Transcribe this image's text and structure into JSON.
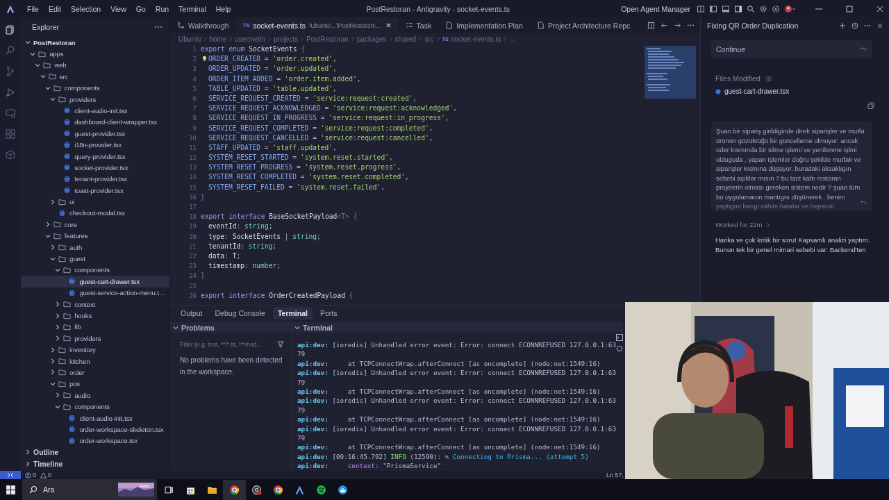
{
  "title_bar": {
    "menu": [
      "File",
      "Edit",
      "Selection",
      "View",
      "Go",
      "Run",
      "Terminal",
      "Help"
    ],
    "title": "PostRestoran - Antigravity - socket-events.ts",
    "agent_manager": "Open Agent Manager"
  },
  "explorer": {
    "title": "Explorer",
    "tree": [
      {
        "name": "PostRestoran",
        "kind": "root",
        "expanded": true,
        "selected": false,
        "children": [
          {
            "name": "apps",
            "kind": "folder",
            "expanded": true,
            "selected": false,
            "children": [
              {
                "name": "web",
                "kind": "folder",
                "expanded": true,
                "selected": false,
                "children": [
                  {
                    "name": "src",
                    "kind": "folder",
                    "expanded": true,
                    "selected": false,
                    "children": [
                      {
                        "name": "components",
                        "kind": "folder",
                        "expanded": true,
                        "selected": false,
                        "children": [
                          {
                            "name": "providers",
                            "kind": "folder",
                            "expanded": true,
                            "selected": false,
                            "children": [
                              {
                                "name": "client-audio-init.tsx",
                                "kind": "file",
                                "selected": false
                              },
                              {
                                "name": "dashboard-client-wrapper.tsx",
                                "kind": "file",
                                "selected": false
                              },
                              {
                                "name": "guest-provider.tsx",
                                "kind": "file",
                                "selected": false
                              },
                              {
                                "name": "i18n-provider.tsx",
                                "kind": "file",
                                "selected": false
                              },
                              {
                                "name": "query-provider.tsx",
                                "kind": "file",
                                "selected": false
                              },
                              {
                                "name": "socket-provider.tsx",
                                "kind": "file",
                                "selected": false
                              },
                              {
                                "name": "tenant-provider.tsx",
                                "kind": "file",
                                "selected": false
                              },
                              {
                                "name": "toast-provider.tsx",
                                "kind": "file",
                                "selected": false
                              }
                            ]
                          },
                          {
                            "name": "ui",
                            "kind": "folder",
                            "expanded": false,
                            "selected": false
                          },
                          {
                            "name": "checkout-modal.tsx",
                            "kind": "file",
                            "selected": false
                          }
                        ]
                      },
                      {
                        "name": "core",
                        "kind": "folder",
                        "expanded": false,
                        "selected": false
                      },
                      {
                        "name": "features",
                        "kind": "folder",
                        "expanded": true,
                        "selected": false,
                        "children": [
                          {
                            "name": "auth",
                            "kind": "folder",
                            "expanded": false,
                            "selected": false
                          },
                          {
                            "name": "guest",
                            "kind": "folder",
                            "expanded": true,
                            "selected": false,
                            "children": [
                              {
                                "name": "components",
                                "kind": "folder",
                                "expanded": true,
                                "selected": false,
                                "children": [
                                  {
                                    "name": "guest-cart-drawer.tsx",
                                    "kind": "file",
                                    "selected": true
                                  },
                                  {
                                    "name": "guest-service-action-menu.t…",
                                    "kind": "file",
                                    "selected": false
                                  }
                                ]
                              },
                              {
                                "name": "context",
                                "kind": "folder",
                                "expanded": false,
                                "selected": false
                              },
                              {
                                "name": "hooks",
                                "kind": "folder",
                                "expanded": false,
                                "selected": false
                              },
                              {
                                "name": "lib",
                                "kind": "folder",
                                "expanded": false,
                                "selected": false
                              },
                              {
                                "name": "providers",
                                "kind": "folder",
                                "expanded": false,
                                "selected": false
                              }
                            ]
                          },
                          {
                            "name": "inventory",
                            "kind": "folder",
                            "expanded": false,
                            "selected": false
                          },
                          {
                            "name": "kitchen",
                            "kind": "folder",
                            "expanded": false,
                            "selected": false
                          },
                          {
                            "name": "order",
                            "kind": "folder",
                            "expanded": false,
                            "selected": false
                          },
                          {
                            "name": "pos",
                            "kind": "folder",
                            "expanded": true,
                            "selected": false,
                            "children": [
                              {
                                "name": "audio",
                                "kind": "folder",
                                "expanded": false,
                                "selected": false
                              },
                              {
                                "name": "components",
                                "kind": "folder",
                                "expanded": true,
                                "selected": false,
                                "children": [
                                  {
                                    "name": "client-audio-init.tsx",
                                    "kind": "file",
                                    "selected": false
                                  },
                                  {
                                    "name": "order-workspace-skeleton.tsx",
                                    "kind": "file",
                                    "selected": false
                                  },
                                  {
                                    "name": "order-workspace.tsx",
                                    "kind": "file",
                                    "selected": false
                                  }
                                ]
                              }
                            ]
                          }
                        ]
                      }
                    ]
                  }
                ]
              }
            ]
          }
        ]
      }
    ],
    "sections": [
      {
        "name": "Outline",
        "expanded": false
      },
      {
        "name": "Timeline",
        "expanded": false
      }
    ]
  },
  "tabs": [
    {
      "label": "Walkthrough",
      "kind": "walkthrough",
      "selected": false
    },
    {
      "label": "socket-events.ts",
      "kind": "code",
      "icon_text": "TS",
      "detail": "\\Ubuntu\\...\\PostRestoran\\...",
      "selected": true
    },
    {
      "label": "Task",
      "kind": "task",
      "selected": false
    },
    {
      "label": "Implementation Plan",
      "kind": "doc",
      "selected": false
    },
    {
      "label": "Project Architecture Repc",
      "kind": "doc",
      "selected": false
    }
  ],
  "breadcrumbs": [
    "Ubuntu",
    "home",
    "usermetin",
    "projects",
    "PostRestoran",
    "packages",
    "shared",
    "src",
    "socket-events.ts",
    "..."
  ],
  "breadcrumb_file_icon": "TS",
  "code": [
    {
      "number": "1",
      "tokens": [
        {
          "kind": "keyword",
          "text": "export enum "
        },
        {
          "kind": "name",
          "text": "SocketEvents "
        },
        {
          "kind": "brace",
          "text": "{"
        }
      ]
    },
    {
      "number": "2",
      "hint": true,
      "indented": true,
      "tokens": [
        {
          "kind": "member",
          "text": "ORDER_CREATED"
        },
        {
          "kind": "punct",
          "text": " = "
        },
        {
          "kind": "string",
          "text": "'order.created'"
        },
        {
          "kind": "punct",
          "text": ","
        }
      ]
    },
    {
      "number": "3",
      "indented": true,
      "tokens": [
        {
          "kind": "member",
          "text": "ORDER_UPDATED"
        },
        {
          "kind": "punct",
          "text": " = "
        },
        {
          "kind": "string",
          "text": "'order.updated'"
        },
        {
          "kind": "punct",
          "text": ","
        }
      ]
    },
    {
      "number": "4",
      "indented": true,
      "tokens": [
        {
          "kind": "member",
          "text": "ORDER_ITEM_ADDED"
        },
        {
          "kind": "punct",
          "text": " = "
        },
        {
          "kind": "string",
          "text": "'order.item.added'"
        },
        {
          "kind": "punct",
          "text": ","
        }
      ]
    },
    {
      "number": "5",
      "indented": true,
      "tokens": [
        {
          "kind": "member",
          "text": "TABLE_UPDATED"
        },
        {
          "kind": "punct",
          "text": " = "
        },
        {
          "kind": "string",
          "text": "'table.updated'"
        },
        {
          "kind": "punct",
          "text": ","
        }
      ]
    },
    {
      "number": "6",
      "indented": true,
      "tokens": [
        {
          "kind": "member",
          "text": "SERVICE_REQUEST_CREATED"
        },
        {
          "kind": "punct",
          "text": " = "
        },
        {
          "kind": "string",
          "text": "'service:request:created'"
        },
        {
          "kind": "punct",
          "text": ","
        }
      ]
    },
    {
      "number": "7",
      "indented": true,
      "tokens": [
        {
          "kind": "member",
          "text": "SERVICE_REQUEST_ACKNOWLEDGED"
        },
        {
          "kind": "punct",
          "text": " = "
        },
        {
          "kind": "string",
          "text": "'service:request:acknowledged'"
        },
        {
          "kind": "punct",
          "text": ","
        }
      ]
    },
    {
      "number": "8",
      "indented": true,
      "tokens": [
        {
          "kind": "member",
          "text": "SERVICE_REQUEST_IN_PROGRESS"
        },
        {
          "kind": "punct",
          "text": " = "
        },
        {
          "kind": "string",
          "text": "'service:request:in_progress'"
        },
        {
          "kind": "punct",
          "text": ","
        }
      ]
    },
    {
      "number": "9",
      "indented": true,
      "tokens": [
        {
          "kind": "member",
          "text": "SERVICE_REQUEST_COMPLETED"
        },
        {
          "kind": "punct",
          "text": " = "
        },
        {
          "kind": "string",
          "text": "'service:request:completed'"
        },
        {
          "kind": "punct",
          "text": ","
        }
      ]
    },
    {
      "number": "10",
      "indented": true,
      "tokens": [
        {
          "kind": "member",
          "text": "SERVICE_REQUEST_CANCELLED"
        },
        {
          "kind": "punct",
          "text": " = "
        },
        {
          "kind": "string",
          "text": "'service:request:cancelled'"
        },
        {
          "kind": "punct",
          "text": ","
        }
      ]
    },
    {
      "number": "11",
      "indented": true,
      "tokens": [
        {
          "kind": "member",
          "text": "STAFF_UPDATED"
        },
        {
          "kind": "punct",
          "text": " = "
        },
        {
          "kind": "string",
          "text": "'staff.updated'"
        },
        {
          "kind": "punct",
          "text": ","
        }
      ]
    },
    {
      "number": "12",
      "indented": true,
      "tokens": [
        {
          "kind": "member",
          "text": "SYSTEM_RESET_STARTED"
        },
        {
          "kind": "punct",
          "text": " = "
        },
        {
          "kind": "string",
          "text": "'system.reset.started'"
        },
        {
          "kind": "punct",
          "text": ","
        }
      ]
    },
    {
      "number": "13",
      "indented": true,
      "tokens": [
        {
          "kind": "member",
          "text": "SYSTEM_RESET_PROGRESS"
        },
        {
          "kind": "punct",
          "text": " = "
        },
        {
          "kind": "string",
          "text": "'system.reset.progress'"
        },
        {
          "kind": "punct",
          "text": ","
        }
      ]
    },
    {
      "number": "14",
      "indented": true,
      "tokens": [
        {
          "kind": "member",
          "text": "SYSTEM_RESET_COMPLETED"
        },
        {
          "kind": "punct",
          "text": " = "
        },
        {
          "kind": "string",
          "text": "'system.reset.completed'"
        },
        {
          "kind": "punct",
          "text": ","
        }
      ]
    },
    {
      "number": "15",
      "indented": true,
      "tokens": [
        {
          "kind": "member",
          "text": "SYSTEM_RESET_FAILED"
        },
        {
          "kind": "punct",
          "text": " = "
        },
        {
          "kind": "string",
          "text": "'system.reset.failed'"
        },
        {
          "kind": "punct",
          "text": ","
        }
      ]
    },
    {
      "number": "16",
      "tokens": [
        {
          "kind": "brace",
          "text": "}"
        }
      ]
    },
    {
      "number": "17"
    },
    {
      "number": "18",
      "tokens": [
        {
          "kind": "keyword",
          "text": "export interface "
        },
        {
          "kind": "name",
          "text": "BaseSocketPayload"
        },
        {
          "kind": "brace",
          "text": "<T> {"
        }
      ]
    },
    {
      "number": "19",
      "indented": true,
      "tokens": [
        {
          "kind": "name",
          "text": "eventId"
        },
        {
          "kind": "punct",
          "text": ": "
        },
        {
          "kind": "type",
          "text": "string"
        },
        {
          "kind": "punct",
          "text": ";"
        }
      ]
    },
    {
      "number": "20",
      "indented": true,
      "tokens": [
        {
          "kind": "name",
          "text": "type"
        },
        {
          "kind": "punct",
          "text": ": "
        },
        {
          "kind": "name",
          "text": "SocketEvents "
        },
        {
          "kind": "punct",
          "text": "| "
        },
        {
          "kind": "type",
          "text": "string"
        },
        {
          "kind": "punct",
          "text": ";"
        }
      ]
    },
    {
      "number": "21",
      "indented": true,
      "tokens": [
        {
          "kind": "name",
          "text": "tenantId"
        },
        {
          "kind": "punct",
          "text": ": "
        },
        {
          "kind": "type",
          "text": "string"
        },
        {
          "kind": "punct",
          "text": ";"
        }
      ]
    },
    {
      "number": "22",
      "indented": true,
      "tokens": [
        {
          "kind": "name",
          "text": "data"
        },
        {
          "kind": "punct",
          "text": ": "
        },
        {
          "kind": "name",
          "text": "T"
        },
        {
          "kind": "punct",
          "text": ";"
        }
      ]
    },
    {
      "number": "23",
      "indented": true,
      "tokens": [
        {
          "kind": "name",
          "text": "timestamp"
        },
        {
          "kind": "punct",
          "text": ": "
        },
        {
          "kind": "type",
          "text": "number"
        },
        {
          "kind": "punct",
          "text": ";"
        }
      ]
    },
    {
      "number": "24",
      "tokens": [
        {
          "kind": "brace",
          "text": "}"
        }
      ]
    },
    {
      "number": "25"
    },
    {
      "number": "26",
      "tokens": [
        {
          "kind": "keyword",
          "text": "export interface "
        },
        {
          "kind": "name",
          "text": "OrderCreatedPayload "
        },
        {
          "kind": "brace",
          "text": "{"
        }
      ]
    }
  ],
  "panel": {
    "tabs": [
      {
        "label": "Output",
        "selected": false
      },
      {
        "label": "Debug Console",
        "selected": false
      },
      {
        "label": "Terminal",
        "selected": true
      },
      {
        "label": "Ports",
        "selected": false
      }
    ],
    "problems": {
      "title": "Problems",
      "filter_placeholder": "Filter (e.g. text, **/*.ts, !**/nod...",
      "message": "No problems have been detected in the workspace."
    },
    "terminal": {
      "title": "Terminal",
      "lines": [
        {
          "tokens": [
            {
              "kind": "prefix",
              "text": "api:dev:"
            },
            {
              "kind": "plain",
              "text": " [ioredis] Unhandled error event: Error: connect ECONNREFUSED 127.0.0.1:63"
            }
          ]
        },
        {
          "tokens": [
            {
              "kind": "plain",
              "text": "79"
            }
          ]
        },
        {
          "tokens": [
            {
              "kind": "prefix",
              "text": "api:dev:"
            },
            {
              "kind": "plain",
              "text": "     at TCPConnectWrap.afterConnect [as oncomplete] (node:net:1549:16)"
            }
          ]
        },
        {
          "tokens": [
            {
              "kind": "prefix",
              "text": "api:dev:"
            },
            {
              "kind": "plain",
              "text": " [ioredis] Unhandled error event: Error: connect ECONNREFUSED 127.0.0.1:63"
            }
          ]
        },
        {
          "tokens": [
            {
              "kind": "plain",
              "text": "79"
            }
          ]
        },
        {
          "tokens": [
            {
              "kind": "prefix",
              "text": "api:dev:"
            },
            {
              "kind": "plain",
              "text": "     at TCPConnectWrap.afterConnect [as oncomplete] (node:net:1549:16)"
            }
          ]
        },
        {
          "tokens": [
            {
              "kind": "prefix",
              "text": "api:dev:"
            },
            {
              "kind": "plain",
              "text": " [ioredis] Unhandled error event: Error: connect ECONNREFUSED 127.0.0.1:63"
            }
          ]
        },
        {
          "tokens": [
            {
              "kind": "plain",
              "text": "79"
            }
          ]
        },
        {
          "tokens": [
            {
              "kind": "prefix",
              "text": "api:dev:"
            },
            {
              "kind": "plain",
              "text": "     at TCPConnectWrap.afterConnect [as oncomplete] (node:net:1549:16)"
            }
          ]
        },
        {
          "tokens": [
            {
              "kind": "prefix",
              "text": "api:dev:"
            },
            {
              "kind": "plain",
              "text": " [ioredis] Unhandled error event: Error: connect ECONNREFUSED 127.0.0.1:63"
            }
          ]
        },
        {
          "tokens": [
            {
              "kind": "plain",
              "text": "79"
            }
          ]
        },
        {
          "tokens": [
            {
              "kind": "prefix",
              "text": "api:dev:"
            },
            {
              "kind": "plain",
              "text": "     at TCPConnectWrap.afterConnect [as oncomplete] (node:net:1549:16)"
            }
          ]
        },
        {
          "tokens": [
            {
              "kind": "prefix",
              "text": "api:dev:"
            },
            {
              "kind": "plain",
              "text": " [09:16:45.792] "
            },
            {
              "kind": "info",
              "text": "INFO"
            },
            {
              "kind": "plain",
              "text": " (12590): ✎ "
            },
            {
              "kind": "cyan",
              "text": "Connecting to Prisma... (attempt 5)"
            }
          ]
        },
        {
          "tokens": [
            {
              "kind": "prefix",
              "text": "api:dev:     "
            },
            {
              "kind": "purple",
              "text": "context"
            },
            {
              "kind": "plain",
              "text": ": \"PrismaService\""
            }
          ]
        }
      ]
    }
  },
  "status_bar": {
    "errors": "0",
    "warnings": "0",
    "position": "Ln 57,"
  },
  "agent": {
    "title": "Fixing QR Order Duplication",
    "continue": "Continue",
    "files_modified": "Files Modified",
    "files_count": "1",
    "files": [
      "guest-cart-drawer.tsx"
    ],
    "user_message": "Şuan bir sipariş girildiginde direk siparişler ve mutfa ürünün gözüktüğü bir güncelleme olmuyor. ancak oder kısmında bir silme işlemi ve yenilenme işlmi olduguda , yapan işlemler doğru şekilde mutfak ve siparişler kısmına düşüyor. buradaki aksaklıgın sebebi açıklar mısın ? bu tarz kafe restoran projelerin olması gereken sistem nedir ? şuan tüm bu uygulamanın mantıgnı düşünerek . benim",
    "user_message_cut": "yaptıgım hangi vahim hatalar ve hepsinin",
    "worked": "Worked for 22m",
    "response": [
      "Harika ve çok kritik bir soru! Kapsamlı analizi yaptım.",
      "Bunun tek bir genel mimari sebebi var: Backend'ten"
    ]
  },
  "taskbar": {
    "search_placeholder": "Ara"
  }
}
